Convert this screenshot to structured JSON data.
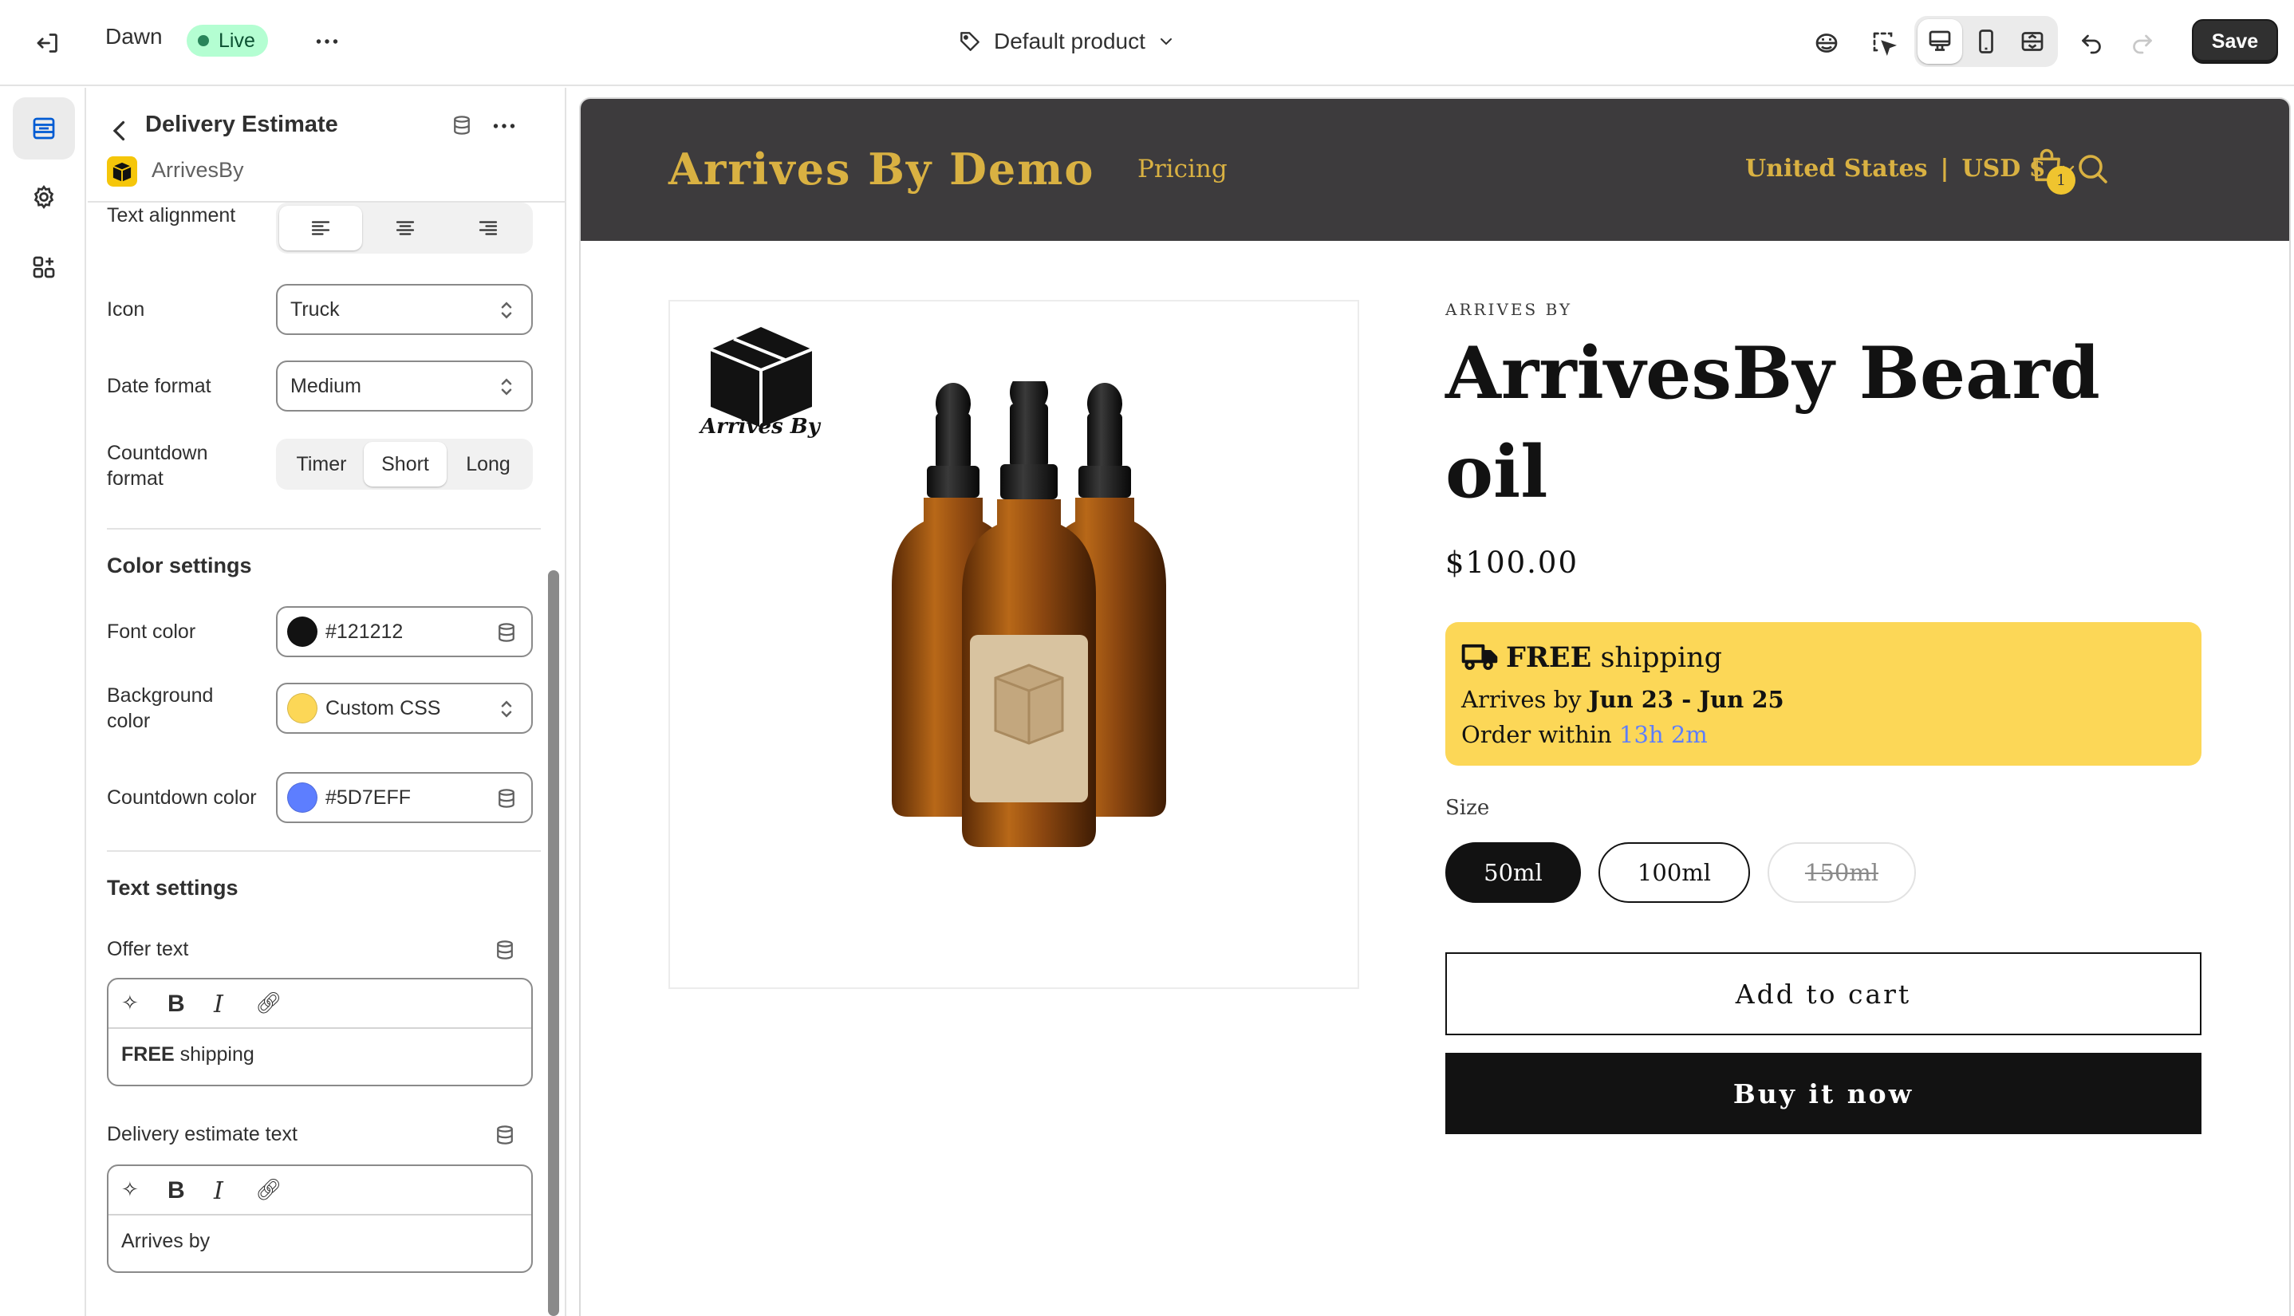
{
  "topbar": {
    "theme_name": "Dawn",
    "live_label": "Live",
    "template_label": "Default product",
    "save_label": "Save"
  },
  "panel": {
    "title": "Delivery Estimate",
    "app_name": "ArrivesBy",
    "text_alignment": {
      "label": "Text alignment",
      "selected": "left"
    },
    "icon": {
      "label": "Icon",
      "value": "Truck"
    },
    "date_format": {
      "label": "Date format",
      "value": "Medium"
    },
    "countdown_format": {
      "label_line1": "Countdown",
      "label_line2": "format",
      "options": [
        "Timer",
        "Short",
        "Long"
      ],
      "selected": "Short"
    },
    "color_settings": {
      "heading": "Color settings",
      "font_color": {
        "label": "Font color",
        "value": "#121212",
        "swatch": "#121212"
      },
      "background_color": {
        "label_line1": "Background",
        "label_line2": "color",
        "value": "Custom CSS",
        "swatch": "#fcd757"
      },
      "countdown_color": {
        "label": "Countdown color",
        "value": "#5D7EFF",
        "swatch": "#5d7eff"
      }
    },
    "text_settings": {
      "heading": "Text settings",
      "offer_text": {
        "label": "Offer text",
        "bold": "FREE",
        "rest": " shipping"
      },
      "delivery_estimate_text": {
        "label": "Delivery estimate text",
        "value": "Arrives by"
      }
    }
  },
  "store": {
    "name": "Arrives By Demo",
    "nav_pricing": "Pricing",
    "country": "United States",
    "currency": "USD $",
    "cart_count": "1",
    "logo_text": "Arrives By",
    "vendor": "ARRIVES BY",
    "product_title": "ArrivesBy Beard oil",
    "price": "$100.00",
    "banner": {
      "free": "FREE",
      "shipping": "shipping",
      "arrives_prefix": "Arrives by ",
      "date_range": "Jun 23 - Jun 25",
      "order_prefix": "Order within ",
      "countdown": "13h 2m",
      "bg_color": "#fcd757",
      "countdown_color": "#5D7EFF"
    },
    "size_label": "Size",
    "sizes": [
      "50ml",
      "100ml",
      "150ml"
    ],
    "selected_size": "50ml",
    "unavailable_size": "150ml",
    "add_to_cart": "Add to cart",
    "buy_now": "Buy it now"
  }
}
